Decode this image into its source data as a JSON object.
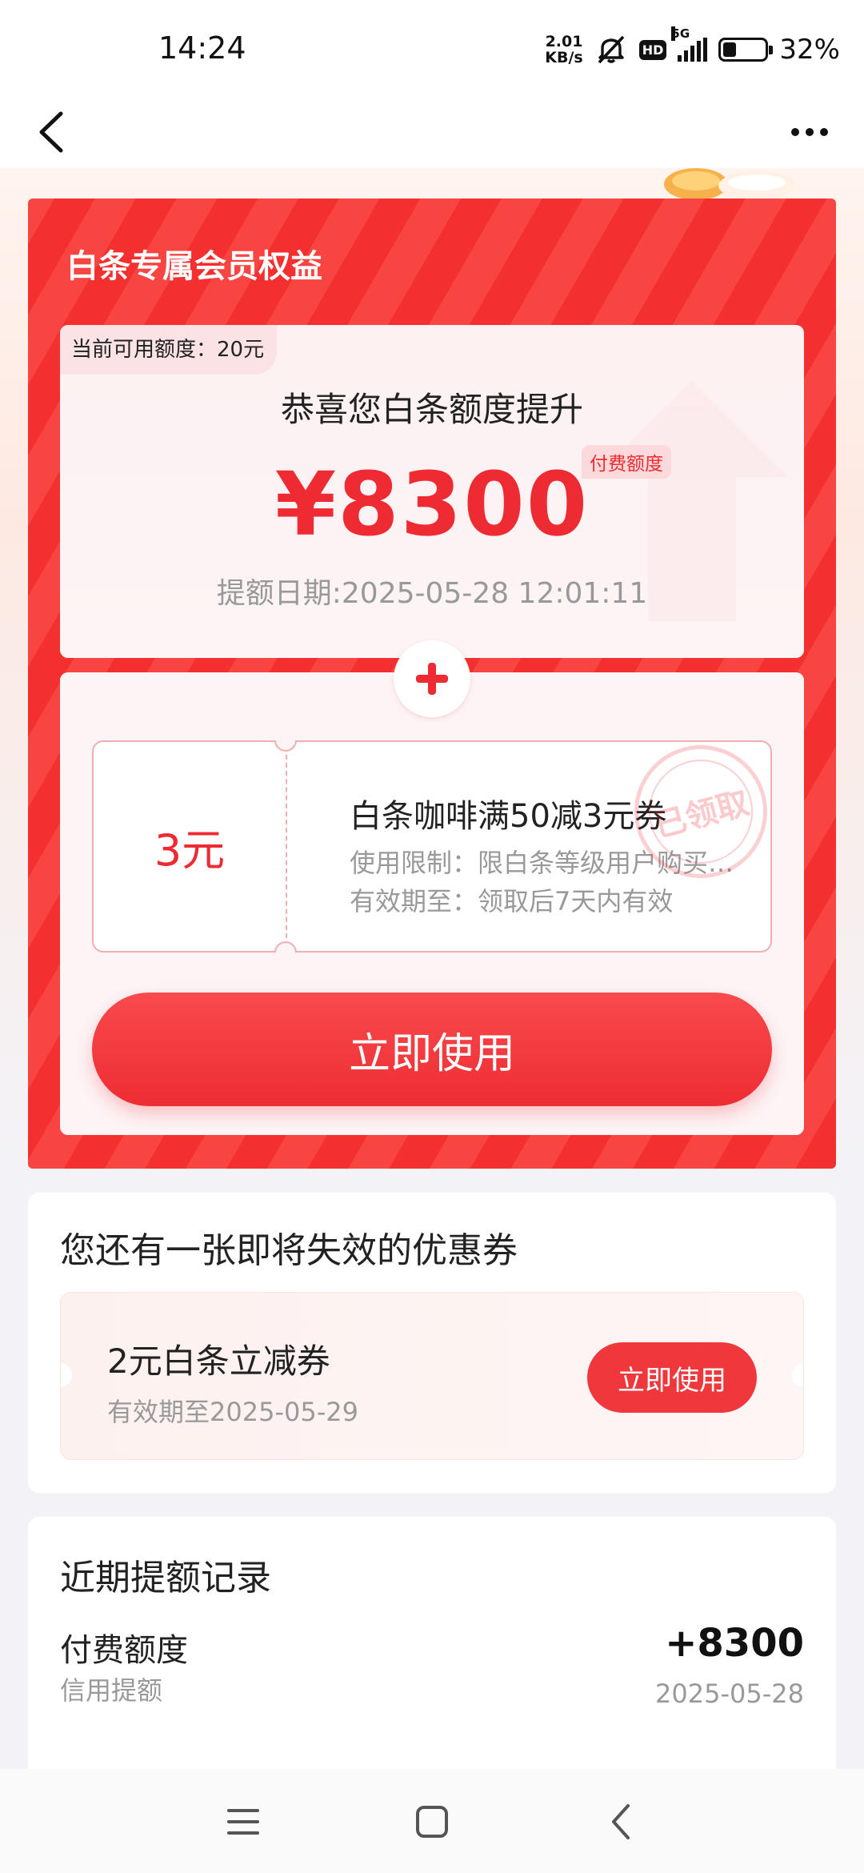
{
  "status_bar": {
    "time": "14:24",
    "net_speed_value": "2.01",
    "net_speed_unit": "KB/s",
    "hd_label": "HD",
    "network_label": "5G",
    "battery_percent": 32,
    "battery_text": "32%"
  },
  "nav": {
    "back_icon": "chevron-left-icon",
    "more_icon": "more-dots-icon"
  },
  "benefits": {
    "title": "白条专属会员权益",
    "available_tag": "当前可用额度：20元",
    "congrats": "恭喜您白条额度提升",
    "amount": "¥8300",
    "amount_tag": "付费额度",
    "raise_date": "提额日期:2025-05-28 12:01:11",
    "coupon": {
      "value": "3元",
      "name": "白条咖啡满50减3元券",
      "limit": "使用限制：限白条等级用户购买指定商品",
      "valid": "有效期至：领取后7天内有效",
      "stamp": "已领取"
    },
    "use_button": "立即使用"
  },
  "expiring": {
    "title": "您还有一张即将失效的优惠券",
    "coupon_name": "2元白条立减券",
    "coupon_date": "有效期至2025-05-29",
    "use_button": "立即使用"
  },
  "records": {
    "title": "近期提额记录",
    "items": [
      {
        "name": "付费额度",
        "sub": "信用提额",
        "amount": "+8300",
        "date": "2025-05-28"
      }
    ]
  },
  "colors": {
    "brand_red": "#ee2b32",
    "card_red": "#f3302f"
  }
}
